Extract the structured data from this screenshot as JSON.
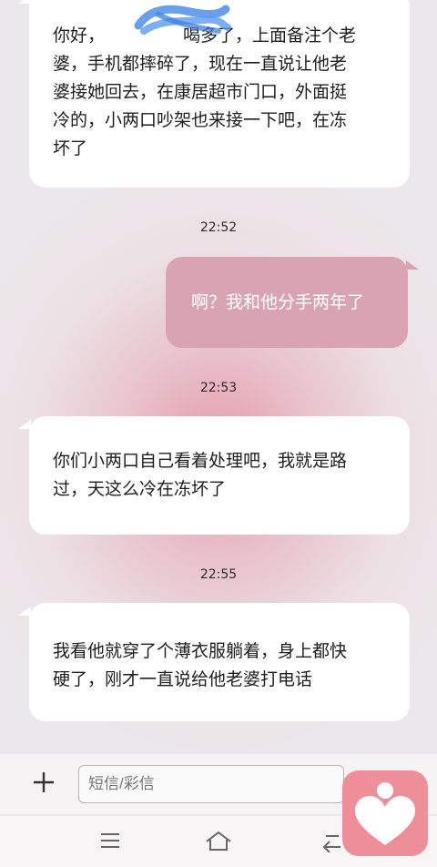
{
  "messages": [
    {
      "type": "incoming",
      "text": "你好，王▇▇▇喝多了，上面备注个老婆，手机都摔碎了，现在一直说让他老婆接她回去，在康居超市门口，外面挺冷的，小两口吵架也来接一下吧，在冻坏了"
    },
    {
      "type": "time",
      "text": "22:52"
    },
    {
      "type": "outgoing",
      "text": "啊？我和他分手两年了"
    },
    {
      "type": "time",
      "text": "22:53"
    },
    {
      "type": "incoming",
      "text": "你们小两口自己看着处理吧，我就是路过，天这么冷在冻坏了"
    },
    {
      "type": "time",
      "text": "22:55"
    },
    {
      "type": "incoming",
      "text": "我看他就穿了个薄衣服躺着，身上都快硬了，刚才一直说给他老婆打电话"
    }
  ],
  "msg1": {
    "line1a": "你好，",
    "line1b": "喝多了，上面备注个老",
    "line2": "婆，手机都摔碎了，现在一直说让他老",
    "line3": "婆接她回去，在康居超市门口，外面挺",
    "line4": "冷的，小两口吵架也来接一下吧，在冻",
    "line5": "坏了"
  },
  "times": {
    "t1": "22:52",
    "t2": "22:53",
    "t3": "22:55"
  },
  "msg2": {
    "text": "啊？我和他分手两年了"
  },
  "msg3": {
    "line1": "你们小两口自己看着处理吧，我就是路",
    "line2": "过，天这么冷在冻坏了"
  },
  "msg4": {
    "line1": "我看他就穿了个薄衣服躺着，身上都快",
    "line2": "硬了，刚才一直说给他老婆打电话"
  },
  "compose": {
    "placeholder": "短信/彩信",
    "add_icon": "plus-icon"
  },
  "nav": {
    "icons": [
      "menu-icon",
      "home-icon",
      "back-icon"
    ]
  },
  "badge": {
    "icon": "heart-person-icon"
  },
  "colors": {
    "outgoing_bubble": "#d8a3b3",
    "incoming_bubble": "#ffffff",
    "badge": "#ee8e99"
  }
}
